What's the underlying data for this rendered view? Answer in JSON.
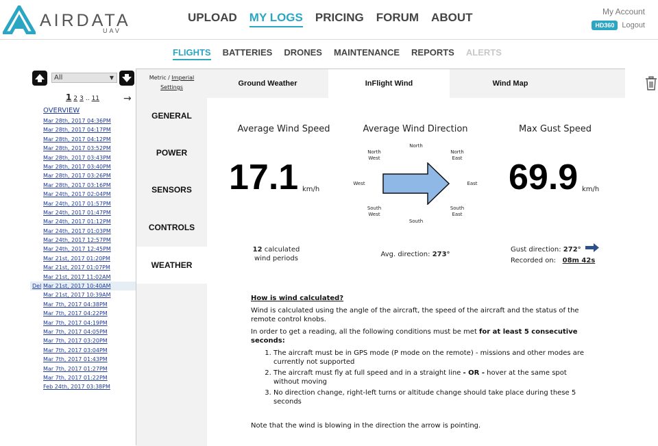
{
  "brand": {
    "name": "AIRDATA",
    "sub": "UAV"
  },
  "mainnav": [
    {
      "label": "UPLOAD",
      "active": false
    },
    {
      "label": "MY LOGS",
      "active": true
    },
    {
      "label": "PRICING",
      "active": false
    },
    {
      "label": "FORUM",
      "active": false
    },
    {
      "label": "ABOUT",
      "active": false
    }
  ],
  "account": {
    "my_account": "My Account",
    "badge": "HD360",
    "logout": "Logout"
  },
  "subnav": [
    {
      "label": "FLIGHTS",
      "state": "active"
    },
    {
      "label": "BATTERIES",
      "state": "normal"
    },
    {
      "label": "DRONES",
      "state": "normal"
    },
    {
      "label": "MAINTENANCE",
      "state": "normal"
    },
    {
      "label": "REPORTS",
      "state": "normal"
    },
    {
      "label": "ALERTS",
      "state": "disabled"
    }
  ],
  "sidebar": {
    "filter_value": "All",
    "pager": {
      "current": "1",
      "p2": "2",
      "p3": "3",
      "ellipsis": "..",
      "last": "11"
    },
    "next": "→",
    "overview": "OVERVIEW",
    "delete_label": "Del",
    "selected_index": 18,
    "flights": [
      "Mar 28th, 2017 04:36PM",
      "Mar 28th, 2017 04:17PM",
      "Mar 28th, 2017 04:12PM",
      "Mar 28th, 2017 03:52PM",
      "Mar 28th, 2017 03:43PM",
      "Mar 28th, 2017 03:40PM",
      "Mar 28th, 2017 03:26PM",
      "Mar 28th, 2017 03:16PM",
      "Mar 24th, 2017 02:04PM",
      "Mar 24th, 2017 01:57PM",
      "Mar 24th, 2017 01:47PM",
      "Mar 24th, 2017 01:12PM",
      "Mar 24th, 2017 01:03PM",
      "Mar 24th, 2017 12:57PM",
      "Mar 24th, 2017 12:45PM",
      "Mar 21st, 2017 01:20PM",
      "Mar 21st, 2017 01:07PM",
      "Mar 21st, 2017 11:02AM",
      "Mar 21st, 2017 10:40AM",
      "Mar 21st, 2017 10:39AM",
      "Mar 7th, 2017 04:38PM",
      "Mar 7th, 2017 04:22PM",
      "Mar 7th, 2017 04:19PM",
      "Mar 7th, 2017 04:05PM",
      "Mar 7th, 2017 03:20PM",
      "Mar 7th, 2017 03:04PM",
      "Mar 7th, 2017 01:43PM",
      "Mar 7th, 2017 01:27PM",
      "Mar 7th, 2017 01:22PM",
      "Feb 24th, 2017 03:38PM"
    ]
  },
  "units": {
    "metric": "Metric",
    "sep": " / ",
    "imperial": "Imperial",
    "settings": "Settings"
  },
  "vtabs": [
    {
      "label": "GENERAL",
      "active": false
    },
    {
      "label": "POWER",
      "active": false
    },
    {
      "label": "SENSORS",
      "active": false
    },
    {
      "label": "CONTROLS",
      "active": false
    },
    {
      "label": "WEATHER",
      "active": true
    }
  ],
  "htabs": [
    {
      "label": "Ground Weather",
      "active": false
    },
    {
      "label": "InFlight Wind",
      "active": true
    },
    {
      "label": "Wind Map",
      "active": false
    }
  ],
  "wind": {
    "avg_speed_title": "Average Wind Speed",
    "avg_speed": "17.1",
    "avg_speed_unit": "km/h",
    "avg_dir_title": "Average Wind Direction",
    "gust_title": "Max Gust Speed",
    "gust": "69.9",
    "gust_unit": "km/h",
    "periods_count": "12",
    "periods_label1": " calculated",
    "periods_label2": "wind periods",
    "avg_dir_label": "Avg. direction: ",
    "avg_dir_value": "273°",
    "gust_dir_label": "Gust direction: ",
    "gust_dir_value": "272°",
    "recorded_label": "Recorded on:",
    "recorded_value": "08m 42s",
    "compass": {
      "n": "North",
      "ne1": "North",
      "ne2": "East",
      "e": "East",
      "se1": "South",
      "se2": "East",
      "s": "South",
      "sw1": "South",
      "sw2": "West",
      "w": "West",
      "nw1": "North",
      "nw2": "West"
    },
    "arrow_color": "#8fb8e6",
    "gust_arrow_color": "#2d4f8c"
  },
  "explain": {
    "heading": "How is wind calculated?",
    "p1": "Wind is calculated using the angle of the aircraft, the speed of the aircraft and the status of the remote control knobs.",
    "p2_normal": "In order to get a reading, all the following conditions must be met ",
    "p2_bold": "for at least 5 consecutive seconds:",
    "li1": "The aircraft must be in GPS mode (P mode on the remote) - missions and other modes are currently not supported",
    "li2_a": "The aircraft must fly at full speed and in a straight line ",
    "li2_b": "- OR -",
    "li2_c": " hover at the same spot without moving",
    "li3": "No direction change, right-left turns or altitude change should take place during these 5 seconds",
    "note": "Note that the wind is blowing in the direction the arrow is pointing."
  },
  "colors": {
    "accent": "#2aa6c3",
    "link": "#1f3a9a",
    "share": "#1f9b3e"
  }
}
